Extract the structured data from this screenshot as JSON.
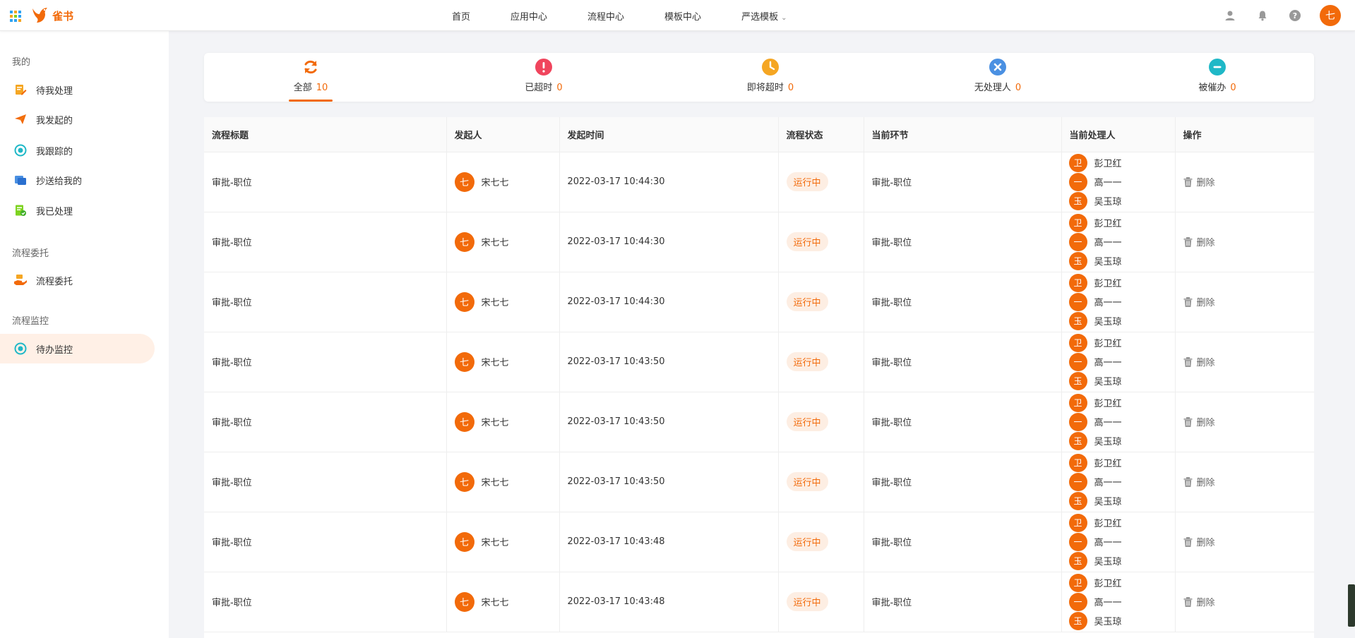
{
  "app": {
    "name": "雀书",
    "brand_color": "#f26a0a"
  },
  "topnav": {
    "items": [
      "首页",
      "应用中心",
      "流程中心",
      "模板中心",
      "严选模板"
    ],
    "avatar": "七"
  },
  "sidebar": {
    "groups": [
      {
        "title": "我的",
        "items": [
          "待我处理",
          "我发起的",
          "我跟踪的",
          "抄送给我的",
          "我已处理"
        ]
      },
      {
        "title": "流程委托",
        "items": [
          "流程委托"
        ]
      },
      {
        "title": "流程监控",
        "items": [
          "待办监控"
        ]
      }
    ]
  },
  "tabs": [
    {
      "label": "全部",
      "count": "10",
      "color": "#f26a0a"
    },
    {
      "label": "已超时",
      "count": "0",
      "color": "#f0455d"
    },
    {
      "label": "即将超时",
      "count": "0",
      "color": "#f5a623"
    },
    {
      "label": "无处理人",
      "count": "0",
      "color": "#4a90e2"
    },
    {
      "label": "被催办",
      "count": "0",
      "color": "#1fb8c7"
    }
  ],
  "table": {
    "headers": [
      "流程标题",
      "发起人",
      "发起时间",
      "流程状态",
      "当前环节",
      "当前处理人",
      "操作"
    ],
    "rows": [
      {
        "title": "审批-职位",
        "initiator_avatar": "七",
        "initiator": "宋七七",
        "time": "2022-03-17 10:44:30",
        "status": "运行中",
        "node": "审批-职位",
        "delete": "删除"
      },
      {
        "title": "审批-职位",
        "initiator_avatar": "七",
        "initiator": "宋七七",
        "time": "2022-03-17 10:44:30",
        "status": "运行中",
        "node": "审批-职位",
        "delete": "删除"
      },
      {
        "title": "审批-职位",
        "initiator_avatar": "七",
        "initiator": "宋七七",
        "time": "2022-03-17 10:44:30",
        "status": "运行中",
        "node": "审批-职位",
        "delete": "删除"
      },
      {
        "title": "审批-职位",
        "initiator_avatar": "七",
        "initiator": "宋七七",
        "time": "2022-03-17 10:43:50",
        "status": "运行中",
        "node": "审批-职位",
        "delete": "删除"
      },
      {
        "title": "审批-职位",
        "initiator_avatar": "七",
        "initiator": "宋七七",
        "time": "2022-03-17 10:43:50",
        "status": "运行中",
        "node": "审批-职位",
        "delete": "删除"
      },
      {
        "title": "审批-职位",
        "initiator_avatar": "七",
        "initiator": "宋七七",
        "time": "2022-03-17 10:43:50",
        "status": "运行中",
        "node": "审批-职位",
        "delete": "删除"
      },
      {
        "title": "审批-职位",
        "initiator_avatar": "七",
        "initiator": "宋七七",
        "time": "2022-03-17 10:43:48",
        "status": "运行中",
        "node": "审批-职位",
        "delete": "删除"
      },
      {
        "title": "审批-职位",
        "initiator_avatar": "七",
        "initiator": "宋七七",
        "time": "2022-03-17 10:43:48",
        "status": "运行中",
        "node": "审批-职位",
        "delete": "删除"
      }
    ],
    "handlers": [
      {
        "avatar": "卫",
        "name": "彭卫红"
      },
      {
        "avatar": "一",
        "name": "高一一"
      },
      {
        "avatar": "玉",
        "name": "吴玉琼"
      }
    ]
  }
}
